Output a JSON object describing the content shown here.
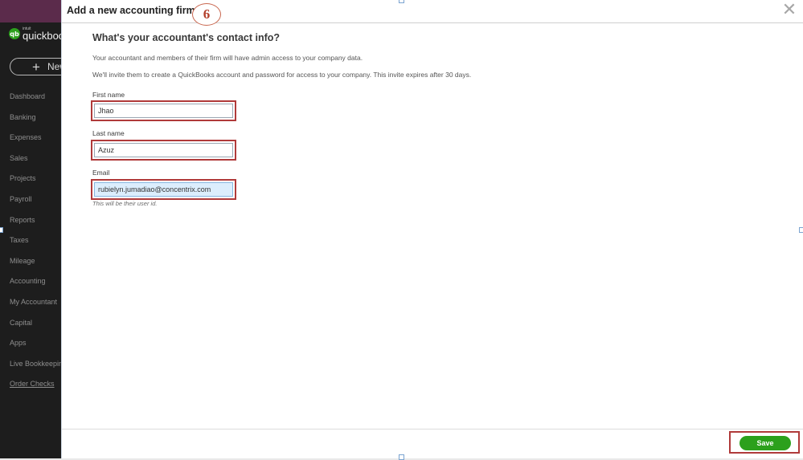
{
  "sidebar": {
    "brand": {
      "intuit": "intuit",
      "name": "quickbooks",
      "logo": "qb"
    },
    "new_button": "New",
    "items": [
      {
        "label": "Dashboard"
      },
      {
        "label": "Banking"
      },
      {
        "label": "Expenses"
      },
      {
        "label": "Sales"
      },
      {
        "label": "Projects"
      },
      {
        "label": "Payroll"
      },
      {
        "label": "Reports"
      },
      {
        "label": "Taxes"
      },
      {
        "label": "Mileage"
      },
      {
        "label": "Accounting"
      },
      {
        "label": "My Accountant"
      },
      {
        "label": "Capital"
      },
      {
        "label": "Apps"
      },
      {
        "label": "Live Bookkeeping"
      },
      {
        "label": "Order Checks"
      }
    ]
  },
  "modal": {
    "title": "Add a new accounting firm",
    "step_badge": "6",
    "close_icon": "close-icon",
    "heading": "What's your accountant's contact info?",
    "description1": "Your accountant and members of their firm will have admin access to your company data.",
    "description2": "We'll invite them to create a QuickBooks account and password for access to your company. This invite expires after 30 days.",
    "fields": {
      "first_name": {
        "label": "First name",
        "value": "Jhao"
      },
      "last_name": {
        "label": "Last name",
        "value": "Azuz"
      },
      "email": {
        "label": "Email",
        "value": "rubielyn.jumadiao@concentrix.com",
        "helper": "This will be their user id."
      }
    },
    "save_label": "Save"
  },
  "colors": {
    "sidebar_bg": "#1d1d1d",
    "accent_green": "#2ca01c",
    "annotation_red": "#b03a3a"
  }
}
